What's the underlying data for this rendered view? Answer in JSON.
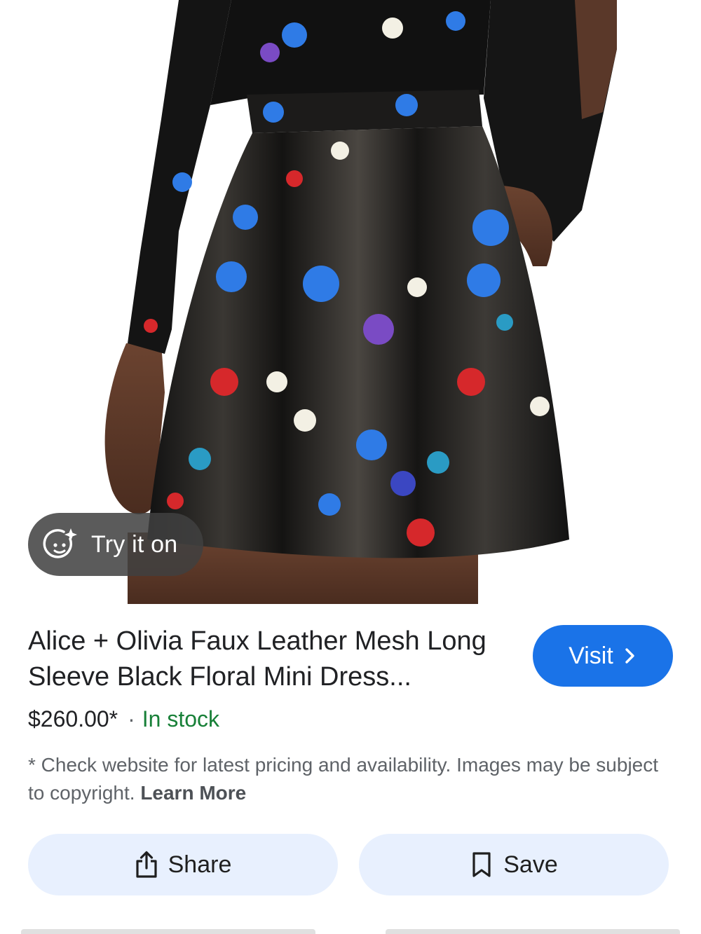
{
  "product": {
    "title": "Alice + Olivia Faux Leather Mesh Long Sleeve Black Floral Mini Dress...",
    "price": "$260.00*",
    "separator": "·",
    "availability": "In stock",
    "availability_color": "#188038"
  },
  "image": {
    "try_on_label": "Try it on",
    "try_on_icon": "sparkle-face-icon"
  },
  "visit_button": {
    "label": "Visit",
    "icon": "chevron-right-icon",
    "color": "#1a73e8"
  },
  "disclaimer": {
    "text": "* Check website for latest pricing and availability. Images may be subject to copyright.",
    "link": "Learn More"
  },
  "actions": {
    "share_label": "Share",
    "share_icon": "share-icon",
    "save_label": "Save",
    "save_icon": "bookmark-icon",
    "background": "#e8f0fe"
  }
}
